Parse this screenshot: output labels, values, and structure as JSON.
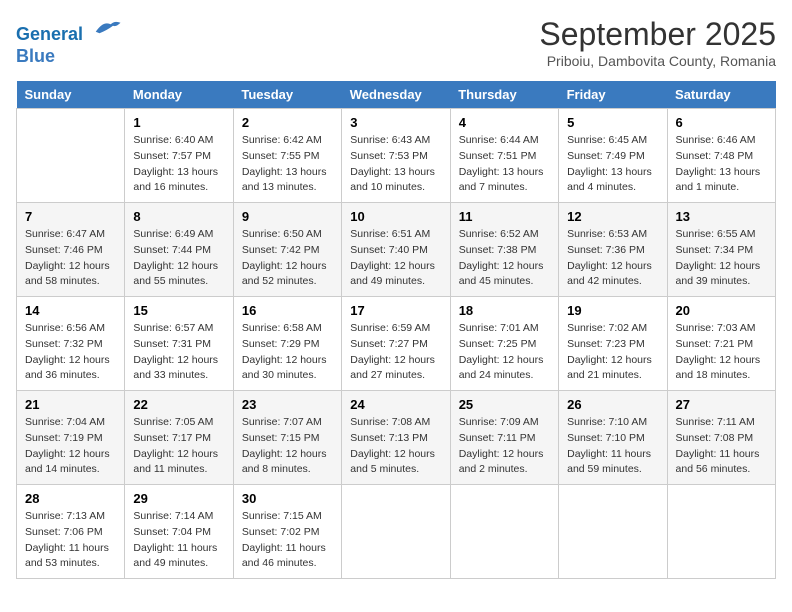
{
  "header": {
    "logo_line1": "General",
    "logo_line2": "Blue",
    "month_title": "September 2025",
    "location": "Priboiu, Dambovita County, Romania"
  },
  "weekdays": [
    "Sunday",
    "Monday",
    "Tuesday",
    "Wednesday",
    "Thursday",
    "Friday",
    "Saturday"
  ],
  "weeks": [
    [
      {
        "day": "",
        "info": ""
      },
      {
        "day": "1",
        "info": "Sunrise: 6:40 AM\nSunset: 7:57 PM\nDaylight: 13 hours\nand 16 minutes."
      },
      {
        "day": "2",
        "info": "Sunrise: 6:42 AM\nSunset: 7:55 PM\nDaylight: 13 hours\nand 13 minutes."
      },
      {
        "day": "3",
        "info": "Sunrise: 6:43 AM\nSunset: 7:53 PM\nDaylight: 13 hours\nand 10 minutes."
      },
      {
        "day": "4",
        "info": "Sunrise: 6:44 AM\nSunset: 7:51 PM\nDaylight: 13 hours\nand 7 minutes."
      },
      {
        "day": "5",
        "info": "Sunrise: 6:45 AM\nSunset: 7:49 PM\nDaylight: 13 hours\nand 4 minutes."
      },
      {
        "day": "6",
        "info": "Sunrise: 6:46 AM\nSunset: 7:48 PM\nDaylight: 13 hours\nand 1 minute."
      }
    ],
    [
      {
        "day": "7",
        "info": "Sunrise: 6:47 AM\nSunset: 7:46 PM\nDaylight: 12 hours\nand 58 minutes."
      },
      {
        "day": "8",
        "info": "Sunrise: 6:49 AM\nSunset: 7:44 PM\nDaylight: 12 hours\nand 55 minutes."
      },
      {
        "day": "9",
        "info": "Sunrise: 6:50 AM\nSunset: 7:42 PM\nDaylight: 12 hours\nand 52 minutes."
      },
      {
        "day": "10",
        "info": "Sunrise: 6:51 AM\nSunset: 7:40 PM\nDaylight: 12 hours\nand 49 minutes."
      },
      {
        "day": "11",
        "info": "Sunrise: 6:52 AM\nSunset: 7:38 PM\nDaylight: 12 hours\nand 45 minutes."
      },
      {
        "day": "12",
        "info": "Sunrise: 6:53 AM\nSunset: 7:36 PM\nDaylight: 12 hours\nand 42 minutes."
      },
      {
        "day": "13",
        "info": "Sunrise: 6:55 AM\nSunset: 7:34 PM\nDaylight: 12 hours\nand 39 minutes."
      }
    ],
    [
      {
        "day": "14",
        "info": "Sunrise: 6:56 AM\nSunset: 7:32 PM\nDaylight: 12 hours\nand 36 minutes."
      },
      {
        "day": "15",
        "info": "Sunrise: 6:57 AM\nSunset: 7:31 PM\nDaylight: 12 hours\nand 33 minutes."
      },
      {
        "day": "16",
        "info": "Sunrise: 6:58 AM\nSunset: 7:29 PM\nDaylight: 12 hours\nand 30 minutes."
      },
      {
        "day": "17",
        "info": "Sunrise: 6:59 AM\nSunset: 7:27 PM\nDaylight: 12 hours\nand 27 minutes."
      },
      {
        "day": "18",
        "info": "Sunrise: 7:01 AM\nSunset: 7:25 PM\nDaylight: 12 hours\nand 24 minutes."
      },
      {
        "day": "19",
        "info": "Sunrise: 7:02 AM\nSunset: 7:23 PM\nDaylight: 12 hours\nand 21 minutes."
      },
      {
        "day": "20",
        "info": "Sunrise: 7:03 AM\nSunset: 7:21 PM\nDaylight: 12 hours\nand 18 minutes."
      }
    ],
    [
      {
        "day": "21",
        "info": "Sunrise: 7:04 AM\nSunset: 7:19 PM\nDaylight: 12 hours\nand 14 minutes."
      },
      {
        "day": "22",
        "info": "Sunrise: 7:05 AM\nSunset: 7:17 PM\nDaylight: 12 hours\nand 11 minutes."
      },
      {
        "day": "23",
        "info": "Sunrise: 7:07 AM\nSunset: 7:15 PM\nDaylight: 12 hours\nand 8 minutes."
      },
      {
        "day": "24",
        "info": "Sunrise: 7:08 AM\nSunset: 7:13 PM\nDaylight: 12 hours\nand 5 minutes."
      },
      {
        "day": "25",
        "info": "Sunrise: 7:09 AM\nSunset: 7:11 PM\nDaylight: 12 hours\nand 2 minutes."
      },
      {
        "day": "26",
        "info": "Sunrise: 7:10 AM\nSunset: 7:10 PM\nDaylight: 11 hours\nand 59 minutes."
      },
      {
        "day": "27",
        "info": "Sunrise: 7:11 AM\nSunset: 7:08 PM\nDaylight: 11 hours\nand 56 minutes."
      }
    ],
    [
      {
        "day": "28",
        "info": "Sunrise: 7:13 AM\nSunset: 7:06 PM\nDaylight: 11 hours\nand 53 minutes."
      },
      {
        "day": "29",
        "info": "Sunrise: 7:14 AM\nSunset: 7:04 PM\nDaylight: 11 hours\nand 49 minutes."
      },
      {
        "day": "30",
        "info": "Sunrise: 7:15 AM\nSunset: 7:02 PM\nDaylight: 11 hours\nand 46 minutes."
      },
      {
        "day": "",
        "info": ""
      },
      {
        "day": "",
        "info": ""
      },
      {
        "day": "",
        "info": ""
      },
      {
        "day": "",
        "info": ""
      }
    ]
  ]
}
